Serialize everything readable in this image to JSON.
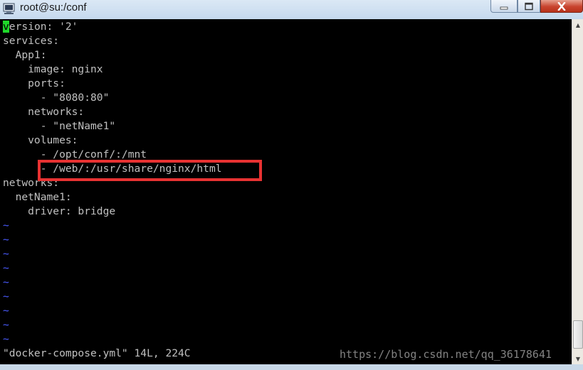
{
  "window": {
    "title": "root@su:/conf",
    "controls": {
      "minimize": "—",
      "maximize": "□",
      "close": "✕"
    }
  },
  "terminal": {
    "cursor_char": "v",
    "lines": [
      "ersion: '2'",
      "services:",
      "  App1:",
      "    image: nginx",
      "    ports:",
      "      - \"8080:80\"",
      "    networks:",
      "      - \"netName1\"",
      "    volumes:",
      "      - /opt/conf/:/mnt",
      "      - /web/:/usr/share/nginx/html",
      "networks:",
      "  netName1:",
      "    driver: bridge"
    ],
    "tilde": "~",
    "tilde_count": 9,
    "status_line": "\"docker-compose.yml\" 14L, 224C"
  },
  "watermark": "https://blog.csdn.net/qq_36178641",
  "icons": {
    "app": "terminal-app-icon",
    "scroll_up": "arrow-up-icon",
    "scroll_down": "arrow-down-icon"
  },
  "colors": {
    "highlight": "#e83232",
    "cursor": "#1fd82a",
    "tilde": "#4a5bff",
    "text": "#c0c0c0"
  }
}
